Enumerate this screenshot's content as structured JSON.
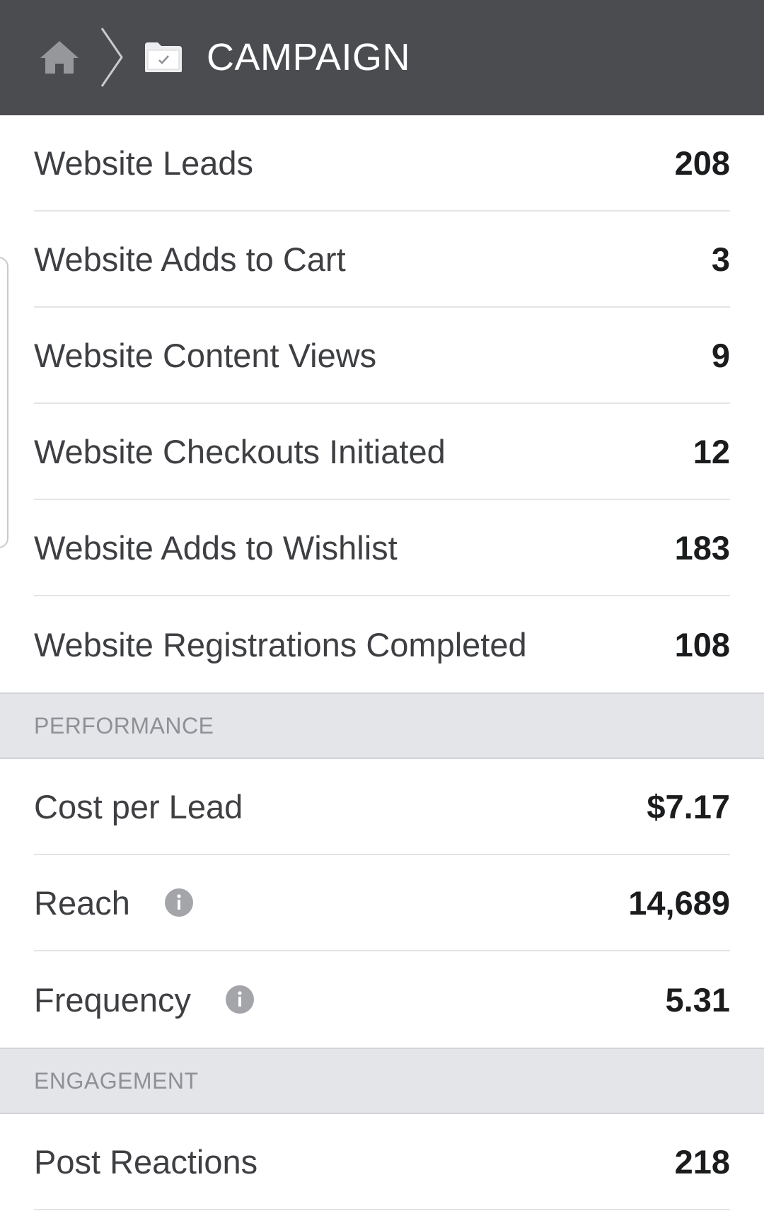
{
  "header": {
    "title": "CAMPAIGN",
    "background_color": "#4b4c50",
    "icons": [
      "home-icon",
      "chevron-right-icon",
      "folder-check-icon"
    ]
  },
  "rows_group1": [
    {
      "label": "Website Leads",
      "value": "208"
    },
    {
      "label": "Website Adds to Cart",
      "value": "3"
    },
    {
      "label": "Website Content Views",
      "value": "9"
    },
    {
      "label": "Website Checkouts Initiated",
      "value": "12"
    },
    {
      "label": "Website Adds to Wishlist",
      "value": "183"
    },
    {
      "label": "Website Registrations Completed",
      "value": "108"
    }
  ],
  "sections": {
    "performance": "PERFORMANCE",
    "engagement": "ENGAGEMENT"
  },
  "rows_performance": [
    {
      "label": "Cost per Lead",
      "value": "$7.17"
    },
    {
      "label": "Reach",
      "value": "14,689"
    },
    {
      "label": "Frequency",
      "value": "5.31"
    }
  ],
  "rows_engagement": [
    {
      "label": "Post Reactions",
      "value": "218"
    }
  ]
}
